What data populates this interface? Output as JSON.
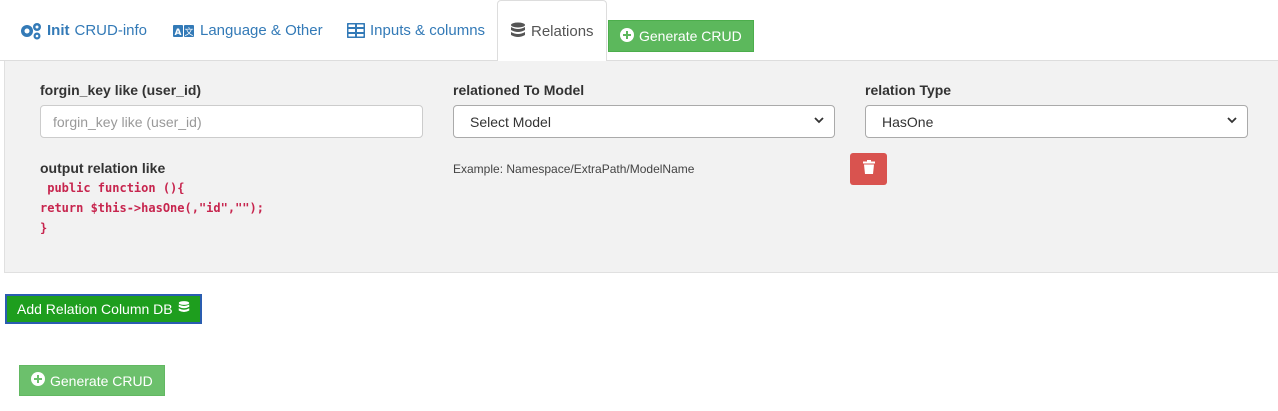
{
  "tabs": [
    {
      "bold": "Init",
      "label": "CRUD-info",
      "icon": "gears-icon"
    },
    {
      "label": "Language & Other",
      "icon": "language-icon"
    },
    {
      "label": "Inputs & columns",
      "icon": "table-icon"
    },
    {
      "label": "Relations",
      "icon": "database-icon",
      "active": true
    }
  ],
  "generate_button_top": "Generate CRUD",
  "relation": {
    "foreign_key_label": "forgin_key like (user_id)",
    "foreign_key_placeholder": "forgin_key like (user_id)",
    "model_label": "relationed To Model",
    "model_select_value": "Select Model",
    "type_label": "relation Type",
    "type_select_value": "HasOne",
    "output_label": "output relation like",
    "code_line1": " public function (){",
    "code_line2": "return $this->hasOne(,\"id\",\"\");",
    "code_line3": "}",
    "example_text": "Example: Namespace/ExtraPath/ModelName"
  },
  "add_relation_button": "Add Relation Column DB",
  "generate_button_bottom": "Generate CRUD",
  "colors": {
    "success": "#5cb85c",
    "danger": "#d9534f",
    "link": "#337ab7",
    "code": "#c7254e"
  }
}
